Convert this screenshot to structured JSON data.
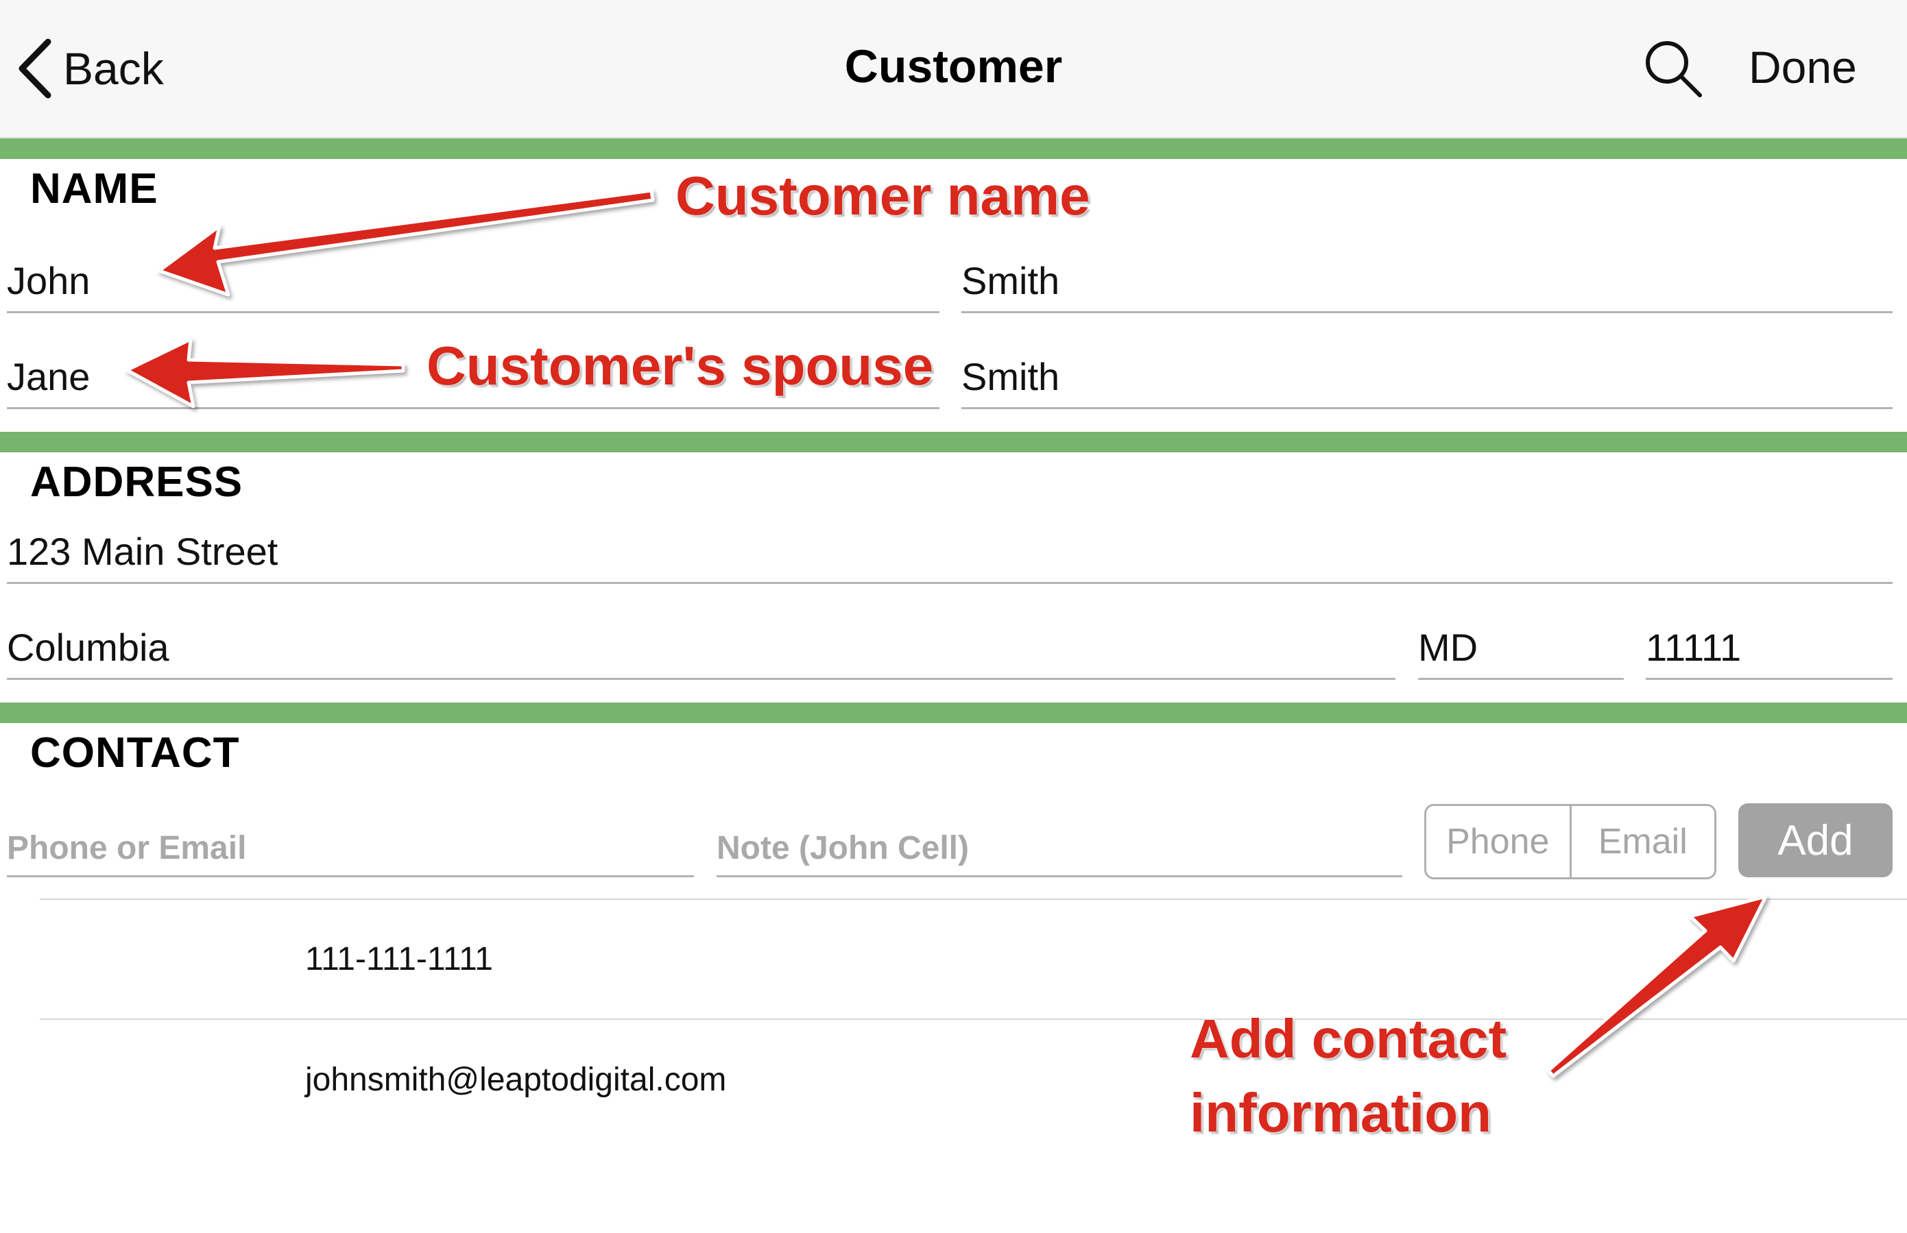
{
  "nav": {
    "back_label": "Back",
    "title": "Customer",
    "done_label": "Done",
    "back_icon": "chevron-left-icon",
    "search_icon": "search-icon"
  },
  "name": {
    "title": "NAME",
    "first_name": "John",
    "last_name": "Smith",
    "spouse_first_name": "Jane",
    "spouse_last_name": "Smith"
  },
  "address": {
    "title": "ADDRESS",
    "street": "123 Main Street",
    "city": "Columbia",
    "state": "MD",
    "zip": "11111"
  },
  "contact": {
    "title": "CONTACT",
    "value_placeholder": "Phone or Email",
    "note_placeholder": "Note (John Cell)",
    "segments": [
      "Phone",
      "Email"
    ],
    "add_label": "Add",
    "entries": [
      "111-111-1111",
      "johnsmith@leaptodigital.com"
    ]
  },
  "annotations": {
    "customer_name": "Customer name",
    "customer_spouse": "Customer's spouse",
    "add_contact_line1": "Add contact",
    "add_contact_line2": "information"
  },
  "colors": {
    "section_bar": "#76b56b",
    "annotation": "#d9281c",
    "add_button": "#a3a3a3"
  }
}
